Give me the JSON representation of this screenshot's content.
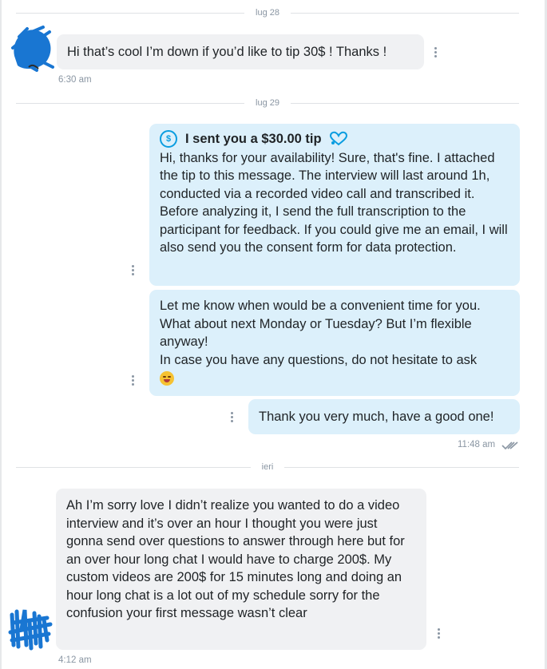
{
  "separators": [
    "lug 28",
    "lug 29",
    "ieri"
  ],
  "messages": {
    "m1": {
      "text": "Hi that’s cool I’m down if you’d like to tip 30$ ! Thanks !",
      "time": "6:30 am"
    },
    "m2": {
      "tip_label": "I sent you a $30.00 tip",
      "coin_symbol": "$",
      "text": "Hi, thanks for your availability! Sure, that's fine. I attached the tip to this message. The interview will last around 1h, conducted via a recorded video call and transcribed it. Before analyzing it, I send the full transcription to the participant for feedback. If you could give me an email, I will also send you the consent form for data protection."
    },
    "m3": {
      "text": "Let me know when would be a convenient time for you. What about next Monday or Tuesday? But I’m flexible anyway!\nIn case you have any questions, do not hesitate to ask"
    },
    "m4": {
      "text": "Thank you very much, have a good one!",
      "time": "11:48 am"
    },
    "m5": {
      "text": "Ah I’m sorry love I didn’t realize you wanted to do a video interview and it’s over an hour I thought you were just gonna send over questions to answer through here but for an over hour long chat I would have to charge 200$. My custom videos are 200$ for 15 minutes long and doing an hour long chat is a lot out of my schedule sorry for the confusion your first message wasn’t clear",
      "time": "4:12 am"
    }
  },
  "colors": {
    "incoming_bubble": "#f0f1f3",
    "outgoing_bubble": "#dcf0fb",
    "accent": "#0a9de0",
    "scribble": "#1976d2"
  },
  "icons": {
    "tip": "dollar-coin-icon",
    "heart": "heart-icon",
    "read": "double-check-icon",
    "emoji": "winking-tongue-emoji",
    "more": "more-options-icon"
  }
}
